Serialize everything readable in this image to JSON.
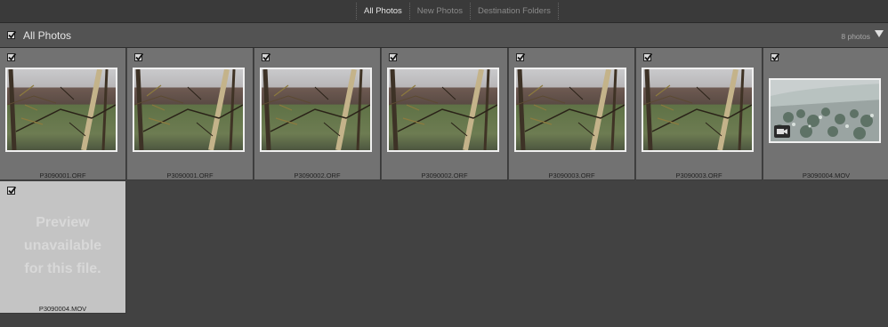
{
  "tabs": [
    {
      "label": "All Photos",
      "active": true
    },
    {
      "label": "New Photos",
      "active": false
    },
    {
      "label": "Destination Folders",
      "active": false
    }
  ],
  "header": {
    "title": "All Photos",
    "count": "8 photos",
    "checked": true
  },
  "photos": [
    {
      "filename": "P3090001.ORF",
      "checked": true,
      "kind": "photo"
    },
    {
      "filename": "P3090001.ORF",
      "checked": true,
      "kind": "photo"
    },
    {
      "filename": "P3090002.ORF",
      "checked": true,
      "kind": "photo"
    },
    {
      "filename": "P3090002.ORF",
      "checked": true,
      "kind": "photo"
    },
    {
      "filename": "P3090003.ORF",
      "checked": true,
      "kind": "photo"
    },
    {
      "filename": "P3090003.ORF",
      "checked": true,
      "kind": "photo"
    },
    {
      "filename": "P3090004.MOV",
      "checked": true,
      "kind": "video",
      "icon": "video-camera-icon"
    },
    {
      "filename": "P3090004.MOV",
      "checked": true,
      "kind": "unavailable",
      "message": "Preview\nunavailable\nfor this file."
    }
  ],
  "colors": {
    "background": "#424242",
    "cell": "#727272",
    "cell_unavailable": "#c4c4c4",
    "header": "#535353"
  }
}
